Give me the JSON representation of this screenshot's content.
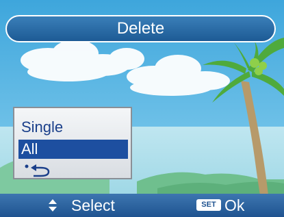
{
  "title": "Delete",
  "menu": {
    "items": [
      {
        "label": "Single",
        "selected": false
      },
      {
        "label": "All",
        "selected": true
      },
      {
        "label": "",
        "icon": "back-arrow-icon",
        "selected": false
      }
    ]
  },
  "footer": {
    "select_icon": "up-down-arrows-icon",
    "select_label": "Select",
    "set_badge": "SET",
    "ok_label": "Ok"
  },
  "colors": {
    "title_bar": "#1d5b95",
    "selected_item": "#1d4fa0",
    "menu_text": "#1a3f8a",
    "footer_bar": "#1f5390",
    "sky": "#4ab3e3"
  }
}
